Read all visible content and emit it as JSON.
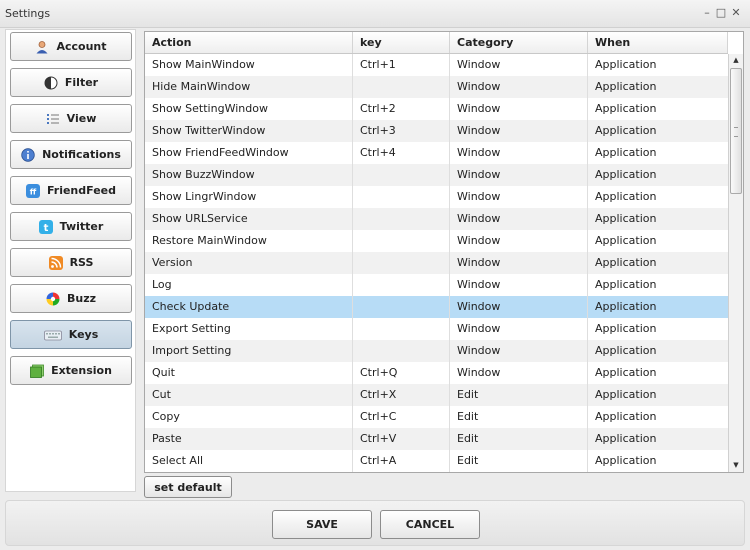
{
  "window": {
    "title": "Settings"
  },
  "sidebar": {
    "items": [
      {
        "label": "Account",
        "icon": "user-icon"
      },
      {
        "label": "Filter",
        "icon": "filter-icon"
      },
      {
        "label": "View",
        "icon": "list-icon"
      },
      {
        "label": "Notifications",
        "icon": "info-icon"
      },
      {
        "label": "FriendFeed",
        "icon": "friendfeed-icon"
      },
      {
        "label": "Twitter",
        "icon": "twitter-icon"
      },
      {
        "label": "RSS",
        "icon": "rss-icon"
      },
      {
        "label": "Buzz",
        "icon": "buzz-icon"
      },
      {
        "label": "Keys",
        "icon": "keyboard-icon",
        "active": true
      },
      {
        "label": "Extension",
        "icon": "extension-icon"
      }
    ]
  },
  "table": {
    "columns": [
      "Action",
      "key",
      "Category",
      "When"
    ],
    "rows": [
      [
        "Show MainWindow",
        "Ctrl+1",
        "Window",
        "Application"
      ],
      [
        "Hide MainWindow",
        "",
        "Window",
        "Application"
      ],
      [
        "Show SettingWindow",
        "Ctrl+2",
        "Window",
        "Application"
      ],
      [
        "Show TwitterWindow",
        "Ctrl+3",
        "Window",
        "Application"
      ],
      [
        "Show FriendFeedWindow",
        "Ctrl+4",
        "Window",
        "Application"
      ],
      [
        "Show BuzzWindow",
        "",
        "Window",
        "Application"
      ],
      [
        "Show LingrWindow",
        "",
        "Window",
        "Application"
      ],
      [
        "Show URLService",
        "",
        "Window",
        "Application"
      ],
      [
        "Restore MainWindow",
        "",
        "Window",
        "Application"
      ],
      [
        "Version",
        "",
        "Window",
        "Application"
      ],
      [
        "Log",
        "",
        "Window",
        "Application"
      ],
      [
        "Check Update",
        "",
        "Window",
        "Application"
      ],
      [
        "Export Setting",
        "",
        "Window",
        "Application"
      ],
      [
        "Import Setting",
        "",
        "Window",
        "Application"
      ],
      [
        "Quit",
        "Ctrl+Q",
        "Window",
        "Application"
      ],
      [
        "Cut",
        "Ctrl+X",
        "Edit",
        "Application"
      ],
      [
        "Copy",
        "Ctrl+C",
        "Edit",
        "Application"
      ],
      [
        "Paste",
        "Ctrl+V",
        "Edit",
        "Application"
      ],
      [
        "Select All",
        "Ctrl+A",
        "Edit",
        "Application"
      ]
    ],
    "selected_row": 11
  },
  "buttons": {
    "set_default": "set default",
    "save": "SAVE",
    "cancel": "CANCEL"
  },
  "colors": {
    "selection": "#b7dcf6",
    "active_nav": "#c4d4e2"
  }
}
